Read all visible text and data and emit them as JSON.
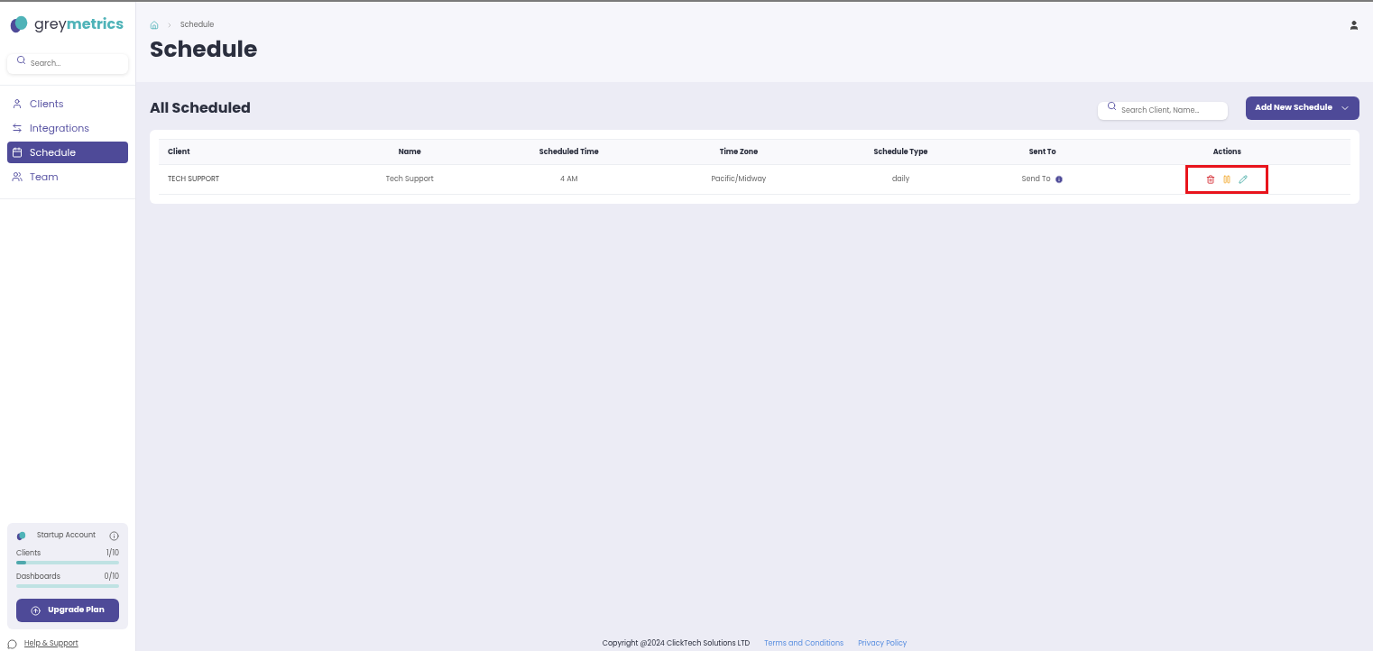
{
  "brand": {
    "prefix": "grey",
    "suffix": "metrics"
  },
  "sidebar": {
    "search": {
      "placeholder": "Search..."
    },
    "items": [
      {
        "label": "Clients",
        "selected": false
      },
      {
        "label": "Integrations",
        "selected": false
      },
      {
        "label": "Schedule",
        "selected": true
      },
      {
        "label": "Team",
        "selected": false
      }
    ],
    "account": {
      "title": "Startup Account",
      "meters": [
        {
          "label": "Clients",
          "reading": "1/10",
          "level": 0.1
        },
        {
          "label": "Dashboards",
          "reading": "0/10",
          "level": 0
        }
      ],
      "button": "Upgrade Plan"
    },
    "help_link": "Help & Support"
  },
  "breadcrumb": [
    "Schedule"
  ],
  "page_title": "Schedule",
  "section_title": "All Scheduled",
  "search": {
    "placeholder": "Search Client, Name..."
  },
  "add_button": "Add New Schedule",
  "table": {
    "columns": [
      "Client",
      "Name",
      "Scheduled Time",
      "Time Zone",
      "Schedule Type",
      "Sent To",
      "Actions"
    ],
    "rows": [
      {
        "client": "TECH SUPPORT",
        "name": "Tech Support",
        "time": "4 AM",
        "zone": "Pacific/Midway",
        "type": "daily",
        "sent_to": "Send To",
        "actions_highlighted": true
      }
    ]
  },
  "footer": {
    "copyright": "Copyright @2024 ClickTech Solutions LTD",
    "links": [
      "Terms and Conditions",
      "Privacy Policy"
    ]
  }
}
